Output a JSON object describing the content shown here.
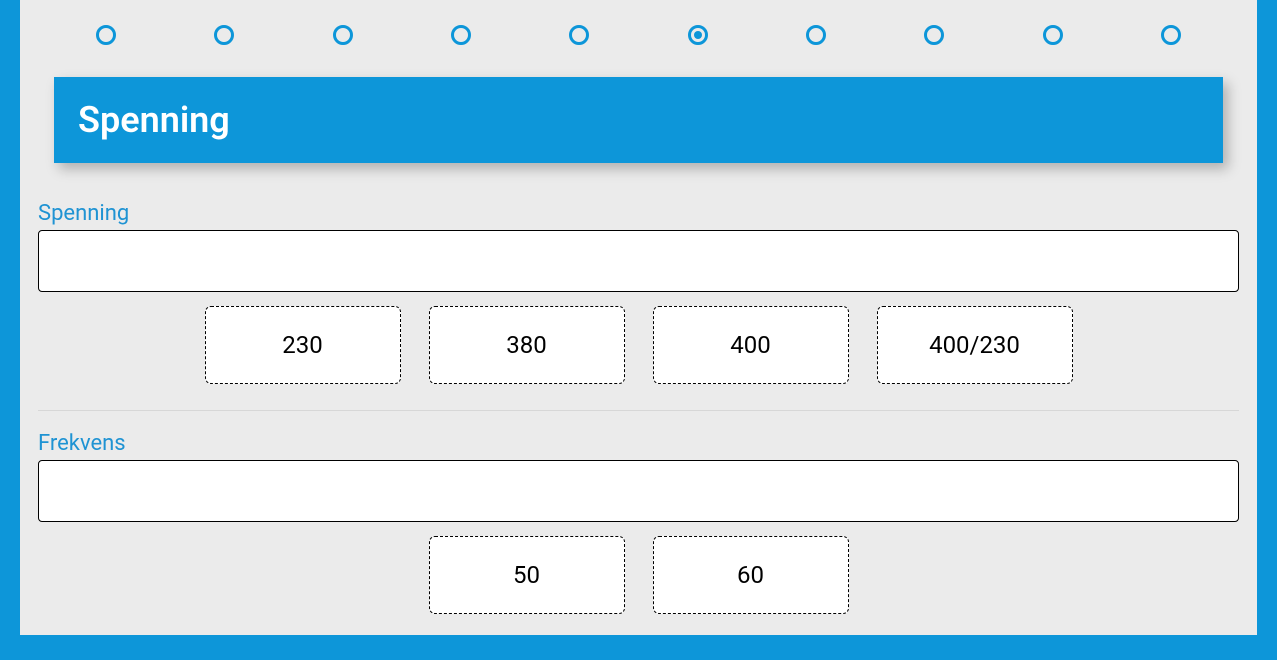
{
  "stepper": {
    "total": 10,
    "activeIndex": 5
  },
  "header": {
    "title": "Spenning"
  },
  "fields": {
    "spenning": {
      "label": "Spenning",
      "value": "",
      "options": [
        "230",
        "380",
        "400",
        "400/230"
      ]
    },
    "frekvens": {
      "label": "Frekvens",
      "value": "",
      "options": [
        "50",
        "60"
      ]
    }
  }
}
